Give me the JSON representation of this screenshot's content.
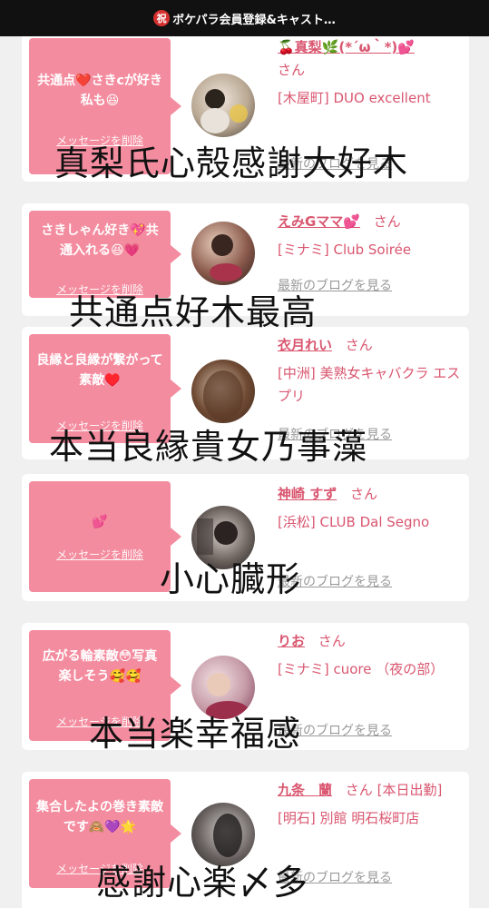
{
  "title_bar": {
    "badge": "祝",
    "text": "ボケパラ会員登録&キャスト…"
  },
  "entries": [
    {
      "message": "共通点❤️さきcが好き私も😆",
      "delete_label": "メッセージを削除",
      "cast_name": "🍒真梨🌿(*´ω｀*)💕",
      "san": "さん",
      "shop": "[木屋町] DUO excellent",
      "blog_link": "最新のブログを見る",
      "overlay_text": "真梨氏心殻感謝大好木"
    },
    {
      "message": "さきしゃん好き💖共通入れる😆💗",
      "delete_label": "メッセージを削除",
      "cast_name": "えみGママ💕",
      "san": "さん",
      "shop": "[ミナミ] Club Soirée",
      "blog_link": "最新のブログを見る",
      "overlay_text": "共通点好木最高"
    },
    {
      "message": "良縁と良縁が繋がって素敵♥️",
      "delete_label": "メッセージを削除",
      "cast_name": "衣月れい",
      "san": "さん",
      "shop": "[中洲] 美熟女キャバクラ エスプリ",
      "blog_link": "最新のブログを見る",
      "overlay_text": "本当良縁貴女乃事藻"
    },
    {
      "message": "💕",
      "delete_label": "メッセージを削除",
      "cast_name": "神崎 すず",
      "san": "さん",
      "shop": "[浜松] CLUB Dal Segno",
      "blog_link": "最新のブログを見る",
      "overlay_text": "小心臓形"
    },
    {
      "message": "広がる輪素敵😳写真楽しそう🥰🥰",
      "delete_label": "メッセージを削除",
      "cast_name": "りお",
      "san": "さん",
      "shop": "[ミナミ] cuore （夜の部）",
      "blog_link": "最新のブログを見る",
      "overlay_text": "本当楽幸福感"
    },
    {
      "message": "集合したよの巻き素敵です🙈💜🌟",
      "delete_label": "メッセージを削除",
      "cast_name": "九条　蘭",
      "san": "さん",
      "status": "[本日出勤]",
      "shop": "[明石] 別館 明石桜町店",
      "blog_link": "最新のブログを見る",
      "overlay_text": "感謝心楽〆多"
    }
  ]
}
